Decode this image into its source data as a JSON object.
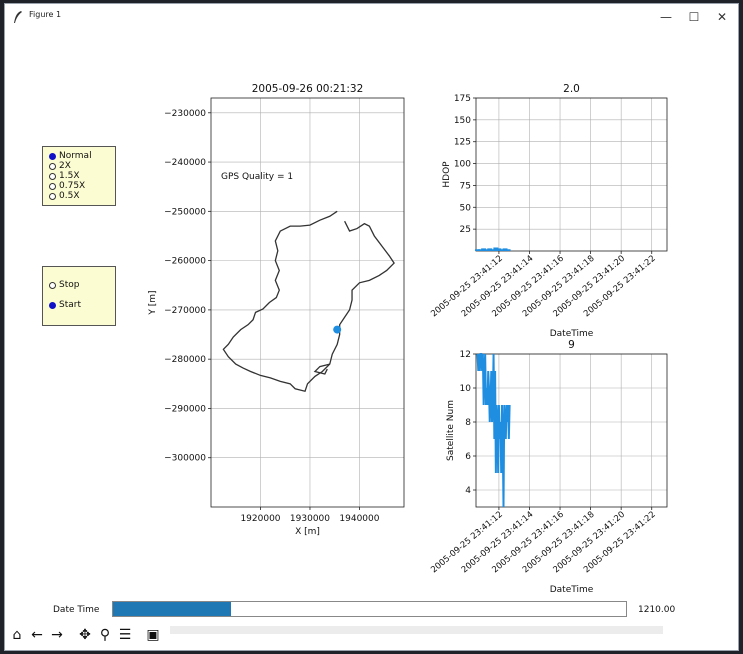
{
  "window": {
    "title": "Figure 1",
    "min_glyph": "—",
    "max_glyph": "☐",
    "close_glyph": "✕"
  },
  "controls": {
    "speed_options": [
      "Normal",
      "2X",
      "1.5X",
      "0.75X",
      "0.5X"
    ],
    "speed_selected": 0,
    "play_options": [
      "Stop",
      "Start"
    ],
    "play_selected": 1,
    "slider": {
      "label": "Date Time",
      "value_text": "1210.00",
      "fraction": 0.23
    }
  },
  "toolbar": [
    "home-icon",
    "back-icon",
    "forward-icon",
    "pan-icon",
    "zoom-icon",
    "configure-icon",
    "save-icon"
  ],
  "chart_data": [
    {
      "type": "line",
      "title": "2005-09-26 00:21:32",
      "xlabel": "X [m]",
      "ylabel": "Y [m]",
      "xlim": [
        1910000,
        1949000
      ],
      "ylim": [
        -310000,
        -227000
      ],
      "xticks": [
        1920000,
        1930000,
        1940000
      ],
      "xtick_labels": [
        "1920000",
        "1930000",
        "1940000"
      ],
      "yticks": [
        -230000,
        -240000,
        -250000,
        -260000,
        -270000,
        -280000,
        -290000,
        -300000
      ],
      "ytick_labels": [
        "−230000",
        "−240000",
        "−250000",
        "−260000",
        "−270000",
        "−280000",
        "−290000",
        "−300000"
      ],
      "annotation": "GPS Quality = 1",
      "grid": true,
      "track": {
        "color": "#333333",
        "points": [
          [
            1935500,
            -250000
          ],
          [
            1934000,
            -251000
          ],
          [
            1932000,
            -251800
          ],
          [
            1930000,
            -252800
          ],
          [
            1928000,
            -253000
          ],
          [
            1926000,
            -253000
          ],
          [
            1924000,
            -254000
          ],
          [
            1923000,
            -256000
          ],
          [
            1923500,
            -258000
          ],
          [
            1923000,
            -260000
          ],
          [
            1923800,
            -262000
          ],
          [
            1923000,
            -264000
          ],
          [
            1923800,
            -266000
          ],
          [
            1923200,
            -267500
          ],
          [
            1921800,
            -268500
          ],
          [
            1920500,
            -269800
          ],
          [
            1919000,
            -270500
          ],
          [
            1918500,
            -272000
          ],
          [
            1917500,
            -273000
          ],
          [
            1916000,
            -274000
          ],
          [
            1914500,
            -275500
          ],
          [
            1913500,
            -277000
          ],
          [
            1912500,
            -278000
          ],
          [
            1913500,
            -279500
          ],
          [
            1915000,
            -281000
          ],
          [
            1916500,
            -281800
          ],
          [
            1918000,
            -282500
          ],
          [
            1920000,
            -283300
          ],
          [
            1922000,
            -283800
          ],
          [
            1924000,
            -284500
          ],
          [
            1926000,
            -285000
          ],
          [
            1927000,
            -286000
          ],
          [
            1929000,
            -286500
          ],
          [
            1929500,
            -285000
          ],
          [
            1931000,
            -283500
          ],
          [
            1932500,
            -282500
          ],
          [
            1934000,
            -281000
          ],
          [
            1934500,
            -279000
          ],
          [
            1935500,
            -277000
          ],
          [
            1936000,
            -275000
          ],
          [
            1936000,
            -273000
          ],
          [
            1937000,
            -271500
          ],
          [
            1938000,
            -270000
          ],
          [
            1938500,
            -268000
          ],
          [
            1938500,
            -266000
          ],
          [
            1940000,
            -264500
          ],
          [
            1942000,
            -264000
          ],
          [
            1944000,
            -263000
          ],
          [
            1945500,
            -262000
          ],
          [
            1947000,
            -260500
          ],
          [
            1946000,
            -259000
          ],
          [
            1944500,
            -257000
          ],
          [
            1943000,
            -255000
          ],
          [
            1942000,
            -253000
          ],
          [
            1941000,
            -252500
          ],
          [
            1939500,
            -253500
          ],
          [
            1938000,
            -254000
          ],
          [
            1937000,
            -252000
          ]
        ],
        "tail": [
          [
            1934000,
            -281000
          ],
          [
            1932000,
            -281500
          ],
          [
            1931000,
            -282500
          ],
          [
            1933000,
            -283000
          ],
          [
            1933500,
            -282000
          ]
        ]
      },
      "marker": {
        "x": 1935500,
        "y": -274000,
        "color": "#1f8ee0"
      }
    },
    {
      "type": "bar",
      "title": "2.0",
      "xlabel": "DateTime",
      "ylabel": "HDOP",
      "ylim": [
        0,
        175
      ],
      "yticks": [
        25,
        50,
        75,
        100,
        125,
        150,
        175
      ],
      "xtick_labels": [
        "2005-09-25 23:41:12",
        "2005-09-25 23:41:14",
        "2005-09-25 23:41:16",
        "2005-09-25 23:41:18",
        "2005-09-25 23:41:20",
        "2005-09-25 23:41:22"
      ],
      "xlim": [
        10.5,
        23.0
      ],
      "xtick_values": [
        12,
        14,
        16,
        18,
        20,
        22
      ],
      "grid": true,
      "color": "#1f8ee0",
      "series": [
        {
          "x": [
            10.6,
            10.8,
            11.0,
            11.2,
            11.4,
            11.6,
            11.8,
            12.0,
            12.2,
            12.4,
            12.6
          ],
          "values": [
            2,
            2,
            3,
            2,
            3,
            2,
            4,
            3,
            2,
            3,
            2
          ]
        }
      ]
    },
    {
      "type": "line",
      "title": "9",
      "xlabel": "DateTime",
      "ylabel": "Satellite Num",
      "ylim": [
        3,
        12
      ],
      "yticks": [
        4,
        6,
        8,
        10,
        12
      ],
      "xtick_labels": [
        "2005-09-25 23:41:12",
        "2005-09-25 23:41:14",
        "2005-09-25 23:41:16",
        "2005-09-25 23:41:18",
        "2005-09-25 23:41:20",
        "2005-09-25 23:41:22"
      ],
      "xlim": [
        10.5,
        23.0
      ],
      "xtick_values": [
        12,
        14,
        16,
        18,
        20,
        22
      ],
      "grid": true,
      "color": "#1f8ee0",
      "series": [
        {
          "x": [
            10.6,
            10.65,
            10.7,
            10.75,
            10.8,
            10.85,
            10.9,
            10.95,
            11.0,
            11.05,
            11.1,
            11.15,
            11.2,
            11.25,
            11.3,
            11.35,
            11.4,
            11.45,
            11.5,
            11.55,
            11.6,
            11.65,
            11.7,
            11.75,
            11.8,
            11.85,
            11.9,
            11.95,
            12.0,
            12.05,
            12.1,
            12.15,
            12.2,
            12.25,
            12.3,
            12.35,
            12.4,
            12.45,
            12.5,
            12.55,
            12.6,
            12.65,
            12.7
          ],
          "values": [
            12,
            11,
            12,
            11,
            12,
            12,
            11,
            12,
            9,
            11,
            12,
            9,
            10,
            9,
            11,
            10,
            8,
            9,
            11,
            8,
            9,
            12,
            7,
            11,
            5,
            9,
            8,
            5,
            9,
            7,
            8,
            5,
            9,
            7,
            3,
            9,
            8,
            7,
            9,
            8,
            9,
            7,
            9
          ]
        }
      ]
    }
  ]
}
